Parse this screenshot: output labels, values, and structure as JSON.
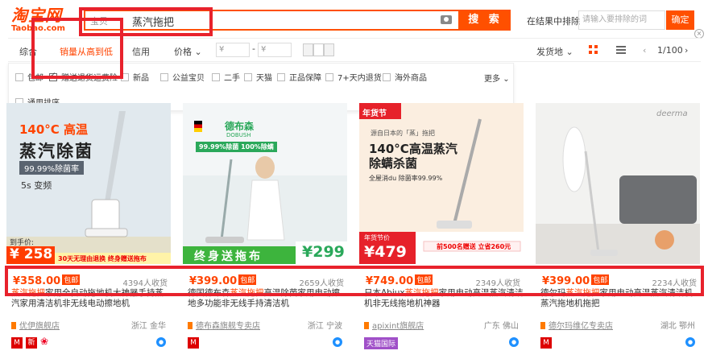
{
  "header": {
    "logo_cn": "淘宝网",
    "logo_en": "Taobao.com",
    "search_scope": "宝贝",
    "search_query": "蒸汽拖把",
    "search_button": "搜 索",
    "in_results_label": "在结果中排除",
    "in_results_placeholder": "请输入要排除的词",
    "confirm": "确定"
  },
  "sortbar": {
    "comprehensive": "综合",
    "sales": "销量从高到低",
    "credit": "信用",
    "price": "价格",
    "price_from": "¥",
    "dash": "-",
    "price_to": "¥",
    "ship_from": "发货地",
    "page": "1/100"
  },
  "filters": {
    "row1": [
      "包邮",
      "赠送退货运费险",
      "新品",
      "公益宝贝",
      "二手",
      "天猫",
      "正品保障",
      "7+天内退货",
      "海外商品"
    ],
    "more": "更多",
    "row2": [
      "通用排序"
    ]
  },
  "products": [
    {
      "img_text1": "140°C 高温",
      "img_text2": "蒸汽除菌",
      "img_text3": "99.99%除菌率",
      "img_text4": "5s 变频",
      "img_price_tag": "到手价:",
      "img_price": "¥ 258",
      "img_strip": "30天无理由退换 终身赠送拖布",
      "price": "¥358.00",
      "free_ship": "包邮",
      "sold": "4394人收货",
      "title_pre": "",
      "title_kw": "蒸汽拖把",
      "title_post": "家用全自动拖地机大神器手持蒸汽家用清洁机非无线电动擦地机",
      "shop": "优伊旗舰店",
      "location": "浙江 金华"
    },
    {
      "img_brand": "德布森",
      "img_brand_en": "DOBUSH",
      "img_banner": "99.99%除菌 100%除螨",
      "img_strip": "终身送拖布",
      "img_price": "¥299",
      "price": "¥399.00",
      "free_ship": "包邮",
      "sold": "2659人收货",
      "title_pre": "德国德布森",
      "title_kw": "蒸汽拖把",
      "title_post": "高温除菌家用电动擦地多功能非无线手持清洁机",
      "shop": "德布森旗舰专卖店",
      "location": "浙江 宁波"
    },
    {
      "img_tag": "年货节",
      "img_sub": "源自日本的「蒸」拖把",
      "img_head1": "140°C高温蒸汽",
      "img_head2": "除螨杀菌",
      "img_line": "全屋消du 除菌率99.99%",
      "img_price_tag": "年货节价",
      "img_price": "¥479",
      "img_promo": "前500名赠送 立省260元",
      "price": "¥749.00",
      "free_ship": "包邮",
      "sold": "2349人收货",
      "title_pre": "日本Abiux",
      "title_kw": "蒸汽拖把",
      "title_post": "家用电动高温蒸汽清洁机非无线拖地机神器",
      "shop": "apixint旗舰店",
      "location": "广东 佛山",
      "shop_badge": "天猫国际"
    },
    {
      "img_brand": "deerma",
      "price": "¥399.00",
      "free_ship": "包邮",
      "sold": "2234人收货",
      "title_pre": "德尔玛",
      "title_kw": "蒸汽拖把",
      "title_post": "家用电动高温蒸汽清洁机蒸汽拖地机拖把",
      "shop": "德尔玛维亿专卖店",
      "location": "湖北 鄂州"
    }
  ],
  "colors": {
    "accent": "#ff4400",
    "highlight_box": "#e8222c"
  }
}
